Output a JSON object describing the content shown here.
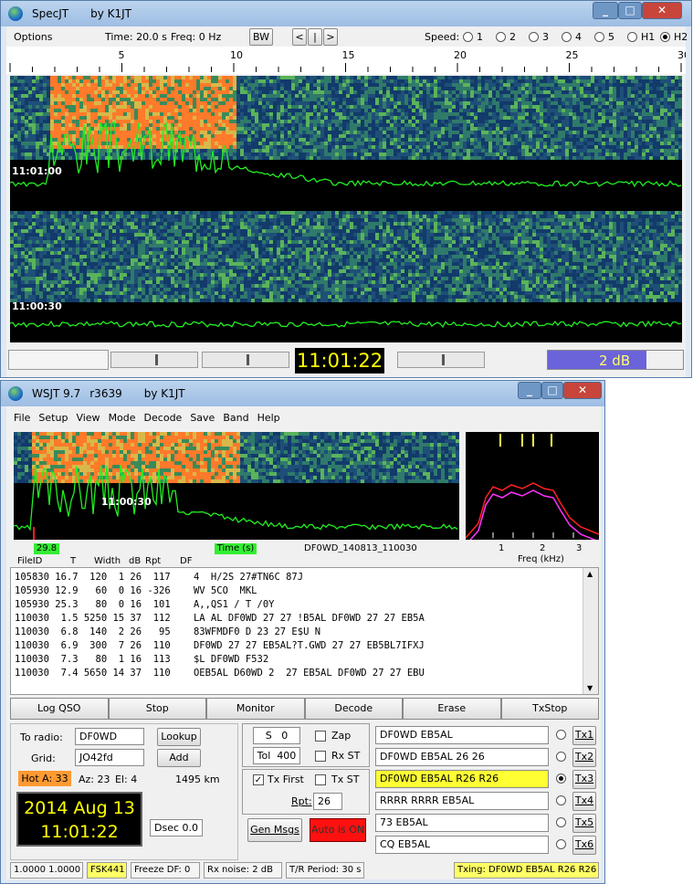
{
  "spec": {
    "title": "SpecJT",
    "author": "by K1JT",
    "options": "Options",
    "time": "Time: 20.0 s",
    "freq": "Freq: 0 Hz",
    "bw": "BW",
    "nav_left": "<",
    "nav_mid": "|",
    "nav_right": ">",
    "speed_label": "Speed:",
    "speeds": [
      "1",
      "2",
      "3",
      "4",
      "5",
      "H1",
      "H2"
    ],
    "speed_selected": "H2",
    "scale": [
      "5",
      "10",
      "15",
      "20",
      "25",
      "30"
    ],
    "ts1": "11:01:00",
    "ts2": "11:00:30",
    "clock": "11:01:22",
    "db": "2 dB"
  },
  "main": {
    "title": "WSJT 9.7",
    "rev": "r3639",
    "author": "by K1JT",
    "menu": [
      "File",
      "Setup",
      "View",
      "Mode",
      "Decode",
      "Save",
      "Band",
      "Help"
    ],
    "plot_ts": "11:00:30",
    "green_val": "29.8",
    "time_axis": "Time (s)",
    "filename": "DF0WD_140813_110030",
    "freq_ticks": [
      "1",
      "2",
      "3"
    ],
    "freq_axis": "Freq (kHz)",
    "headers": [
      "FileID",
      "T",
      "Width",
      "dB",
      "Rpt",
      "DF"
    ],
    "rows": [
      "105830 16.7  120  1 26  117    4  H/2S 27#TN6C 87J",
      "105930 12.9   60  0 16 -326    WV 5CO  MKL",
      "105930 25.3   80  0 16  101    A,,QS1 / T /0Y",
      "110030  1.5 5250 15 37  112    LA AL DF0WD 27 27 !B5AL DF0WD 27 27 EB5A",
      "110030  6.8  140  2 26   95    83WFMDF0 D 23 27 E$U N",
      "110030  6.9  300  7 26  110    DF0WD 27 27 EB5AL?T.GWD 27 27 EB5BL7IFXJ",
      "110030  7.3   80  1 16  113    $L DF0WD F532",
      "110030  7.4 5650 14 37  110    OEB5AL D60WD 2  27 EB5AL DF0WD 27 27 EBU"
    ],
    "actions": [
      "Log QSO",
      "Stop",
      "Monitor",
      "Decode",
      "Erase",
      "TxStop"
    ],
    "to_radio_label": "To radio:",
    "to_radio": "DF0WD",
    "lookup": "Lookup",
    "grid_label": "Grid:",
    "grid": "JO42fd",
    "add": "Add",
    "hot": "Hot A: 33",
    "az": "Az: 23",
    "el": "El: 4",
    "dist": "1495 km",
    "date": "2014 Aug 13",
    "clock": "11:01:22",
    "dsec": "Dsec  0.0",
    "s_label": "S",
    "s_val": "0",
    "tol_label": "Tol",
    "tol_val": "400",
    "zap": "Zap",
    "rxst": "Rx ST",
    "txfirst": "Tx First",
    "txst": "Tx ST",
    "rpt_label": "Rpt:",
    "rpt_val": "26",
    "genmsgs": "Gen Msgs",
    "autois": "Auto is  ON",
    "tx_msgs": [
      "DF0WD EB5AL",
      "DF0WD EB5AL 26 26",
      "DF0WD EB5AL R26 R26",
      "RRRR RRRR EB5AL",
      "73 EB5AL",
      "CQ EB5AL"
    ],
    "tx_btns": [
      "Tx1",
      "Tx2",
      "Tx3",
      "Tx4",
      "Tx5",
      "Tx6"
    ],
    "tx_selected": 2,
    "status": [
      "1.0000 1.0000",
      "FSK441",
      "Freeze DF:  0",
      "Rx noise:  2 dB",
      "T/R Period: 30 s"
    ],
    "txing": "Txing:  DF0WD EB5AL R26 R26"
  },
  "colors": {
    "accent": "#ffff66",
    "red": "#ff1010",
    "hot": "#ff9a33",
    "clockbg": "#000000",
    "clockfg": "#ffff00"
  }
}
